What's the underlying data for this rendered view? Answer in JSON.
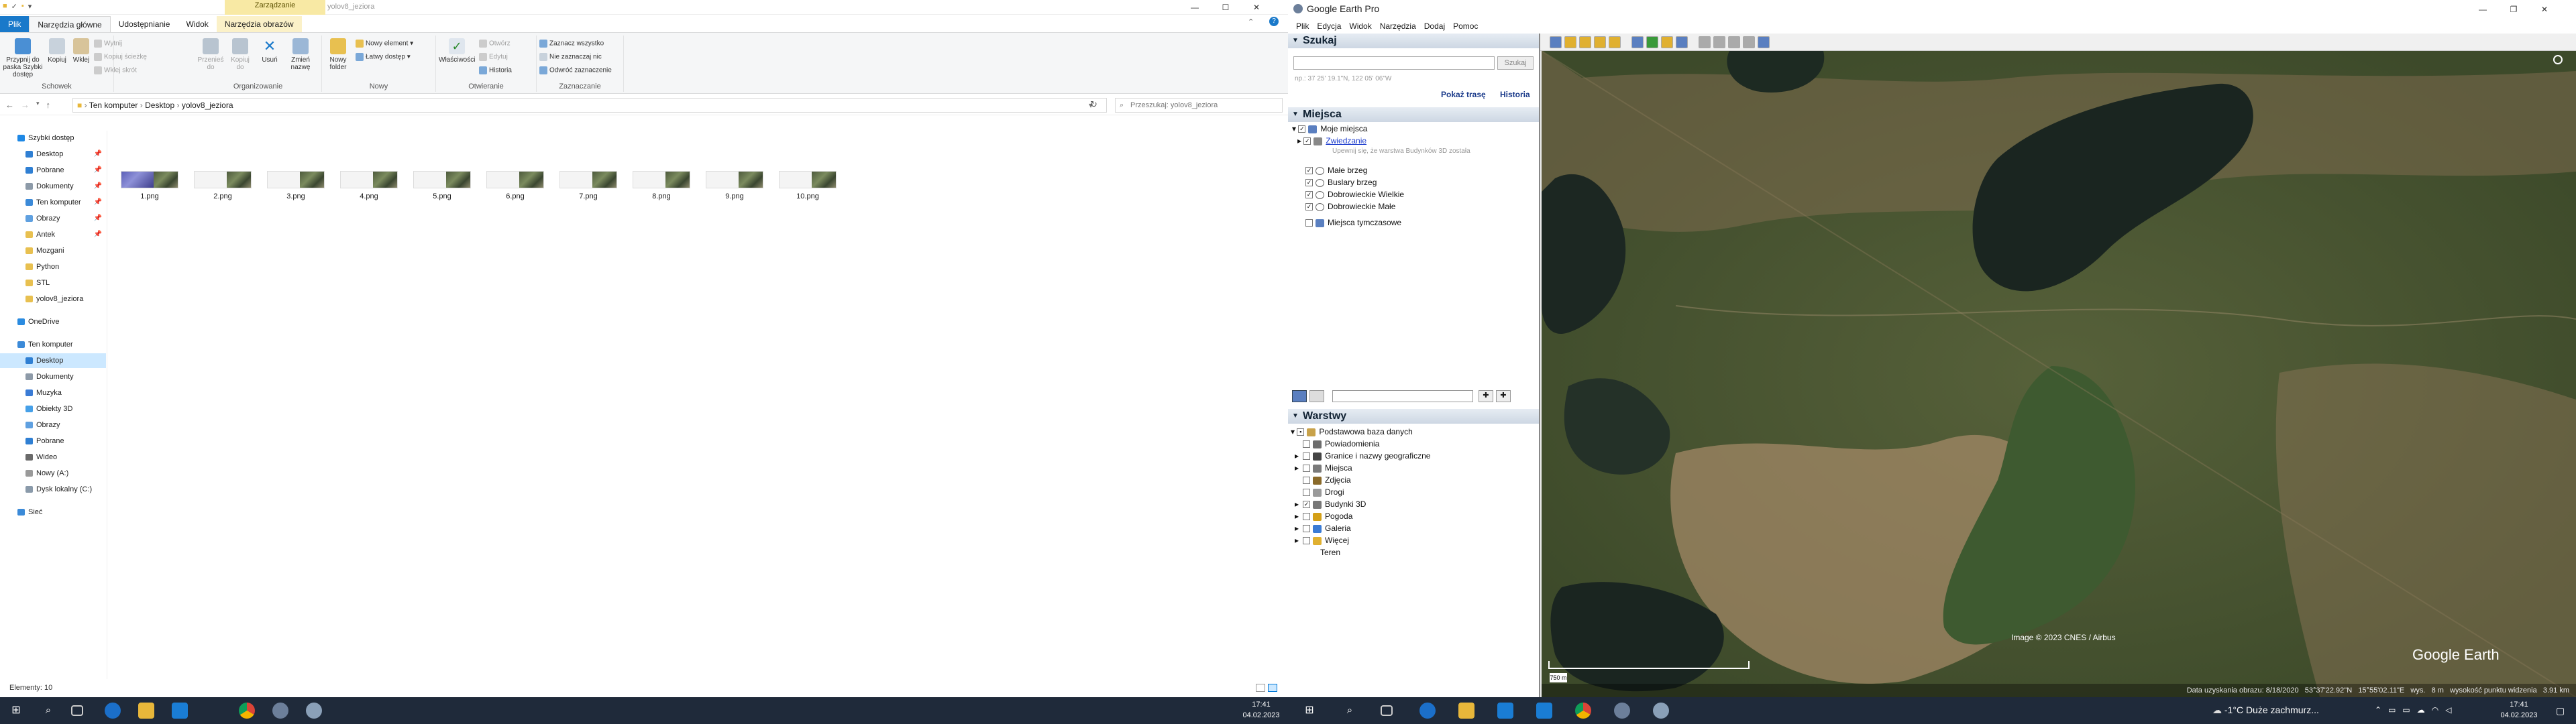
{
  "explorer": {
    "title": "yolov8_jeziora",
    "context_tab_group": "Zarządzanie",
    "tabs": [
      "Plik",
      "Narzędzia główne",
      "Udostępnianie",
      "Widok",
      "Narzędzia obrazów"
    ],
    "ribbon": {
      "schowek": {
        "label": "Schowek",
        "pin": "Przypnij do paska Szybki dostęp",
        "copy": "Kopiuj",
        "paste": "Wklej",
        "cut": "Wytnij",
        "copy_path": "Kopiuj ścieżkę",
        "paste_shortcut": "Wklej skrót"
      },
      "organizowanie": {
        "label": "Organizowanie",
        "move_to": "Przenieś do",
        "copy_to": "Kopiuj do",
        "delete": "Usuń",
        "rename": "Zmień nazwę"
      },
      "nowy": {
        "label": "Nowy",
        "new_folder": "Nowy folder",
        "new_item": "Nowy element",
        "easy_access": "Łatwy dostęp"
      },
      "otwieranie": {
        "label": "Otwieranie",
        "properties": "Właściwości",
        "open": "Otwórz",
        "edit": "Edytuj",
        "history": "Historia"
      },
      "zaznaczanie": {
        "label": "Zaznaczanie",
        "select_all": "Zaznacz wszystko",
        "select_none": "Nie zaznaczaj nic",
        "invert": "Odwróć zaznaczenie"
      }
    },
    "address": {
      "path": [
        "Ten komputer",
        "Desktop",
        "yolov8_jeziora"
      ],
      "search_placeholder": "Przeszukaj: yolov8_jeziora"
    },
    "nav": [
      {
        "label": "Szybki dostęp",
        "color": "#1e88e5",
        "level": 0,
        "pinned": false
      },
      {
        "label": "Desktop",
        "color": "#2f7fd3",
        "level": 1,
        "pinned": true
      },
      {
        "label": "Pobrane",
        "color": "#2f7fd3",
        "level": 1,
        "pinned": true
      },
      {
        "label": "Dokumenty",
        "color": "#8d9aa8",
        "level": 1,
        "pinned": true
      },
      {
        "label": "Ten komputer",
        "color": "#3b8ad8",
        "level": 1,
        "pinned": true
      },
      {
        "label": "Obrazy",
        "color": "#5fa0e0",
        "level": 1,
        "pinned": true
      },
      {
        "label": "Antek",
        "color": "#e8c050",
        "level": 1,
        "pinned": true
      },
      {
        "label": "Mozgani",
        "color": "#e8c050",
        "level": 1,
        "pinned": false
      },
      {
        "label": "Python",
        "color": "#e8c050",
        "level": 1,
        "pinned": false
      },
      {
        "label": "STL",
        "color": "#e8c050",
        "level": 1,
        "pinned": false
      },
      {
        "label": "yolov8_jeziora",
        "color": "#e8c050",
        "level": 1,
        "pinned": false
      },
      {
        "label": "",
        "color": "",
        "level": -1,
        "pinned": false
      },
      {
        "label": "OneDrive",
        "color": "#2a8be0",
        "level": 0,
        "pinned": false
      },
      {
        "label": "",
        "color": "",
        "level": -1,
        "pinned": false
      },
      {
        "label": "Ten komputer",
        "color": "#3b8ad8",
        "level": 0,
        "pinned": false
      },
      {
        "label": "Desktop",
        "color": "#2f7fd3",
        "level": 1,
        "pinned": false,
        "selected": true
      },
      {
        "label": "Dokumenty",
        "color": "#8d9aa8",
        "level": 1,
        "pinned": false
      },
      {
        "label": "Muzyka",
        "color": "#3a7bd5",
        "level": 1,
        "pinned": false
      },
      {
        "label": "Obiekty 3D",
        "color": "#46a0e8",
        "level": 1,
        "pinned": false
      },
      {
        "label": "Obrazy",
        "color": "#5fa0e0",
        "level": 1,
        "pinned": false
      },
      {
        "label": "Pobrane",
        "color": "#2f7fd3",
        "level": 1,
        "pinned": false
      },
      {
        "label": "Wideo",
        "color": "#6a6a6a",
        "level": 1,
        "pinned": false
      },
      {
        "label": "Nowy (A:)",
        "color": "#9a9a9a",
        "level": 1,
        "pinned": false
      },
      {
        "label": "Dysk lokalny (C:)",
        "color": "#8a9aaa",
        "level": 1,
        "pinned": false
      },
      {
        "label": "",
        "color": "",
        "level": -1,
        "pinned": false
      },
      {
        "label": "Sieć",
        "color": "#3b8ad8",
        "level": 0,
        "pinned": false
      }
    ],
    "files": [
      "1.png",
      "2.png",
      "3.png",
      "4.png",
      "5.png",
      "6.png",
      "7.png",
      "8.png",
      "9.png",
      "10.png"
    ],
    "status": "Elementy: 10"
  },
  "earth": {
    "title": "Google Earth Pro",
    "menu": [
      "Plik",
      "Edycja",
      "Widok",
      "Narzędzia",
      "Dodaj",
      "Pomoc"
    ],
    "search": {
      "header": "Szukaj",
      "button": "Szukaj",
      "hint": "np.: 37 25' 19.1\"N, 122 05' 06\"W",
      "route": "Pokaż trasę",
      "history": "Historia"
    },
    "places": {
      "header": "Miejsca",
      "root": "Moje miejsca",
      "tour": "Zwiedzanie",
      "tour_hint": "Upewnij się, że warstwa Budynków 3D została",
      "items": [
        "Małe brzeg",
        "Buslary brzeg",
        "Dobrowieckie Wielkie",
        "Dobrowieckie Małe"
      ],
      "temp": "Miejsca tymczasowe"
    },
    "layers": {
      "header": "Warstwy",
      "root": "Podstawowa baza danych",
      "items": [
        {
          "label": "Powiadomienia",
          "checked": false,
          "expand": false,
          "color": "#6d6d6d"
        },
        {
          "label": "Granice i nazwy geograficzne",
          "checked": false,
          "expand": true,
          "color": "#444"
        },
        {
          "label": "Miejsca",
          "checked": false,
          "expand": true,
          "color": "#7a7a7a"
        },
        {
          "label": "Zdjęcia",
          "checked": false,
          "expand": false,
          "color": "#8a6a2a"
        },
        {
          "label": "Drogi",
          "checked": false,
          "expand": false,
          "color": "#9a9a9a"
        },
        {
          "label": "Budynki 3D",
          "checked": true,
          "expand": true,
          "color": "#777"
        },
        {
          "label": "Pogoda",
          "checked": false,
          "expand": true,
          "color": "#d4a017"
        },
        {
          "label": "Galeria",
          "checked": false,
          "expand": true,
          "color": "#3a7bd5"
        },
        {
          "label": "Więcej",
          "checked": false,
          "expand": true,
          "color": "#e0b030"
        },
        {
          "label": "Teren",
          "checked": false,
          "expand": false,
          "color": ""
        }
      ]
    },
    "map": {
      "attribution": "Image © 2023 CNES / Airbus",
      "logo": "Google Earth",
      "scale": "750 m",
      "status": "Data uzyskania obrazu: 8/18/2020   53°37'22.92\"N   15°55'02.11\"E   wys.   8 m   wysokość punktu widzenia   3.91 km"
    }
  },
  "taskbar_left": {
    "time": "17:41",
    "date": "04.02.2023"
  },
  "taskbar_right": {
    "weather": "-1°C  Duże zachmurz...",
    "time": "17:41",
    "date": "04.02.2023"
  }
}
